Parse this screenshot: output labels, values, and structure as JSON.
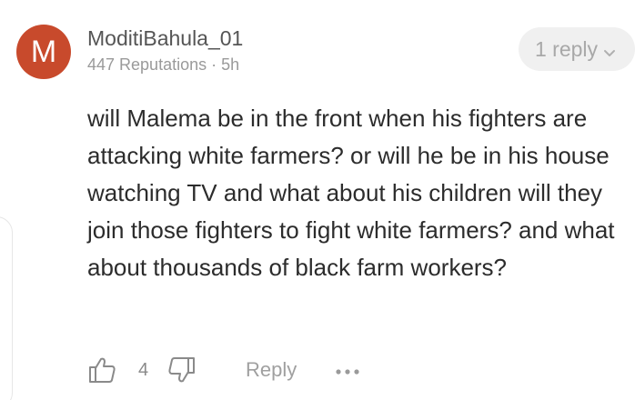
{
  "comment": {
    "avatar_letter": "M",
    "avatar_color": "#c84a2c",
    "username": "ModitiBahula_01",
    "meta": "447 Reputations · 5h",
    "replies_label": "1 reply",
    "text": "will Malema be in the front when his fighters are attacking white farmers? or will he be in his house watching TV and what about his children will they join those fighters to fight white farmers? and what about thousands of black farm workers?",
    "likes": "4",
    "reply_label": "Reply"
  },
  "icons": {
    "like": "thumbs-up-icon",
    "dislike": "thumbs-down-icon",
    "more": "more-dots-icon",
    "expand": "chevron-down-icon"
  }
}
